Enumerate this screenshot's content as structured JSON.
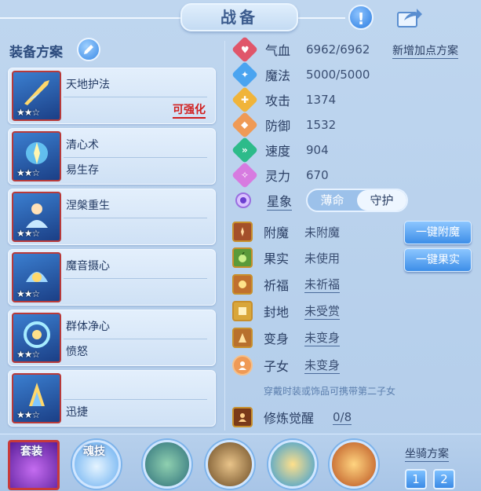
{
  "header": {
    "title": "战备"
  },
  "equipment": {
    "title": "装备方案",
    "plans": [
      {
        "name": "天地护法",
        "sub": "",
        "badge": "可强化",
        "stars": "★★☆",
        "color": "#2f6ec8"
      },
      {
        "name": "清心术",
        "sub": "易生存",
        "badge": "",
        "stars": "★★☆",
        "color": "#2a78c4"
      },
      {
        "name": "涅槃重生",
        "sub": "",
        "badge": "",
        "stars": "★★☆",
        "color": "#3360b0"
      },
      {
        "name": "魔音摄心",
        "sub": "",
        "badge": "",
        "stars": "★★☆",
        "color": "#2f7ecc"
      },
      {
        "name": "群体净心",
        "sub": "愤怒",
        "badge": "",
        "stars": "★★☆",
        "color": "#2d6fbf"
      },
      {
        "name": "",
        "sub": "迅捷",
        "badge": "",
        "stars": "★★☆",
        "color": "#2e6cc2"
      }
    ]
  },
  "stats": {
    "add_plan": "新增加点方案",
    "rows": [
      {
        "label": "气血",
        "value": "6962/6962",
        "color": "#e0566a",
        "glyph": "♥"
      },
      {
        "label": "魔法",
        "value": "5000/5000",
        "color": "#4aa4f0",
        "glyph": "✦"
      },
      {
        "label": "攻击",
        "value": "1374",
        "color": "#f0b43a",
        "glyph": "✚"
      },
      {
        "label": "防御",
        "value": "1532",
        "color": "#ef9a56",
        "glyph": "◆"
      },
      {
        "label": "速度",
        "value": "904",
        "color": "#2dbb8a",
        "glyph": "»"
      },
      {
        "label": "灵力",
        "value": "670",
        "color": "#d77be0",
        "glyph": "✧"
      }
    ],
    "star": {
      "label": "星象",
      "options": [
        "薄命",
        "守护"
      ],
      "selected": "守护"
    }
  },
  "enhance": {
    "rows": [
      {
        "label": "附魔",
        "value": "未附魔",
        "underline": false,
        "color": "#a4502a"
      },
      {
        "label": "果实",
        "value": "未使用",
        "underline": false,
        "color": "#5a9a3a"
      },
      {
        "label": "祈福",
        "value": "未祈福",
        "underline": true,
        "color": "#c0702e"
      },
      {
        "label": "封地",
        "value": "未受赏",
        "underline": true,
        "color": "#d9a63a"
      },
      {
        "label": "变身",
        "value": "未变身",
        "underline": true,
        "color": "#b8702e"
      },
      {
        "label": "子女",
        "value": "未变身",
        "underline": true,
        "color": "#ef9a56"
      }
    ],
    "enchant_button": "一键附魔",
    "fruit_button": "一键果实",
    "hint": "穿戴时装或饰品可携带第二子女",
    "awaken": {
      "label": "修炼觉醒",
      "value": "0/8"
    }
  },
  "bottom": {
    "suit_label": "套装",
    "soul_label": "魂技",
    "mount_title": "坐骑方案",
    "mount_options": [
      "1",
      "2"
    ]
  }
}
